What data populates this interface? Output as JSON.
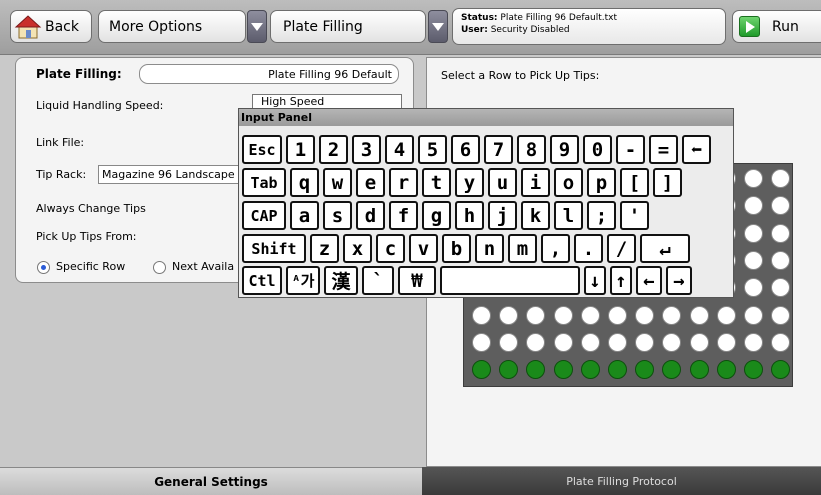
{
  "toolbar": {
    "back_label": "Back",
    "more_options_label": "More Options",
    "plate_filling_label": "Plate Filling",
    "status_key": "Status:",
    "status_value": "Plate Filling 96 Default.txt",
    "user_key": "User:",
    "user_value": "Security Disabled",
    "run_label": "Run"
  },
  "form": {
    "plate_filling_label": "Plate Filling:",
    "plate_filling_value": "Plate Filling 96 Default",
    "speed_label": "Liquid Handling Speed:",
    "speed_value": "High Speed",
    "link_file_label": "Link File:",
    "tip_rack_label": "Tip Rack:",
    "tip_rack_value": "Magazine 96 Landscape",
    "always_change_label": "Always Change Tips",
    "pick_up_from_label": "Pick Up Tips From:",
    "specific_row_label": "Specific Row",
    "next_available_label": "Next Availa"
  },
  "right": {
    "instruction": "Select a Row to Pick Up Tips:"
  },
  "plate": {
    "well_colors": {
      "empty": "#ffffff",
      "filled": "#1a8a1a"
    }
  },
  "input_panel": {
    "title": "Input Panel",
    "rows": [
      [
        "Esc",
        "1",
        "2",
        "3",
        "4",
        "5",
        "6",
        "7",
        "8",
        "9",
        "0",
        "-",
        "=",
        "⬅"
      ],
      [
        "Tab",
        "q",
        "w",
        "e",
        "r",
        "t",
        "y",
        "u",
        "i",
        "o",
        "p",
        "[",
        "]"
      ],
      [
        "CAP",
        "a",
        "s",
        "d",
        "f",
        "g",
        "h",
        "j",
        "k",
        "l",
        ";",
        "'"
      ],
      [
        "Shift",
        "z",
        "x",
        "c",
        "v",
        "b",
        "n",
        "m",
        ",",
        ".",
        "/",
        "↵"
      ],
      [
        "Ctl",
        "ᴬ가",
        "漢",
        "`",
        "₩",
        "",
        "↓",
        "↑",
        "←",
        "→"
      ]
    ]
  },
  "tabs": {
    "general": "General Settings",
    "protocol": "Plate Filling Protocol"
  }
}
